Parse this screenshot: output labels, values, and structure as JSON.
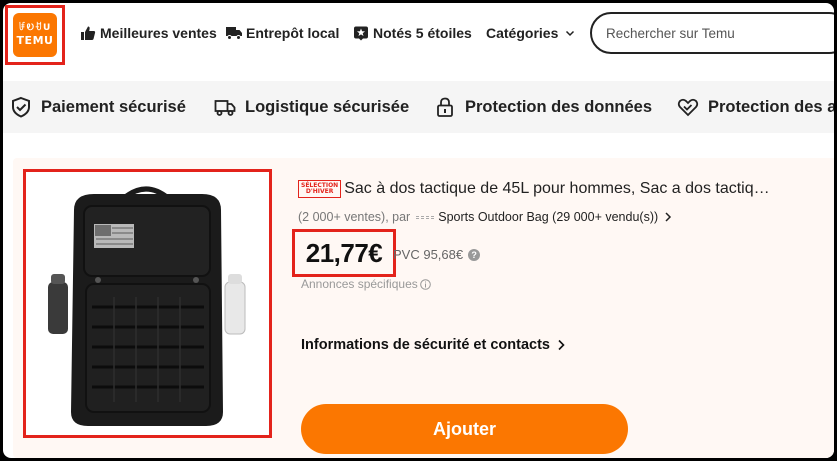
{
  "header": {
    "logo": {
      "glyphs": "ꀱᎧꀀU",
      "word": "TEMU"
    },
    "nav": [
      {
        "label": "Meilleures ventes",
        "icon": "thumbs-up-icon"
      },
      {
        "label": "Entrepôt local",
        "icon": "truck-icon"
      },
      {
        "label": "Notés 5 étoiles",
        "icon": "star-badge-icon"
      },
      {
        "label": "Catégories",
        "icon": "chevron-down-icon"
      }
    ],
    "search_placeholder": "Rechercher sur Temu"
  },
  "trust_bar": [
    {
      "label": "Paiement sécurisé",
      "icon": "shield-check-icon"
    },
    {
      "label": "Logistique sécurisée",
      "icon": "truck-icon"
    },
    {
      "label": "Protection des données",
      "icon": "lock-icon"
    },
    {
      "label": "Protection des ac",
      "icon": "handshake-heart-icon"
    }
  ],
  "product": {
    "badge_line1": "SÉLECTION",
    "badge_line2": "D'HIVER",
    "title": "Sac à dos tactique de 45L pour hommes, Sac a dos tactiq…",
    "sales": "(2 000+ ventes), par",
    "seller": "Sports Outdoor Bag (29 000+ vendu(s))",
    "price": "21,77€",
    "rrp": "PVC 95,68€",
    "ads_label": "Annonces spécifiques",
    "info_link": "Informations de sécurité et contacts",
    "add_button": "Ajouter"
  },
  "colors": {
    "accent": "#fb7701",
    "highlight_box": "#e3231b",
    "card_bg": "#fff8f4",
    "trust_bg": "#f5f5f5"
  }
}
